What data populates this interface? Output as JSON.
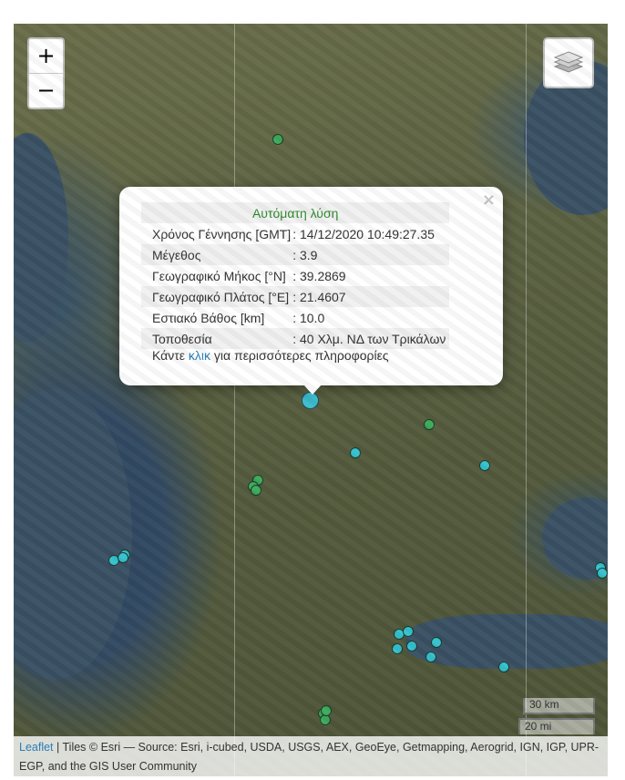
{
  "map": {
    "zoom_in": "+",
    "zoom_out": "−",
    "layers_icon": "layers-icon"
  },
  "popup": {
    "heading": "Αυτόματη λύση",
    "rows": [
      {
        "label": "Χρόνος Γέννησης [GMT]",
        "value": ": 14/12/2020 10:49:27.35"
      },
      {
        "label": "Μέγεθος",
        "value": ": 3.9"
      },
      {
        "label": "Γεωγραφικό Μήκος [°N]",
        "value": ": 39.2869"
      },
      {
        "label": "Γεωγραφικό Πλάτος [°E]",
        "value": ": 21.4607"
      },
      {
        "label": "Εστιακό Βάθος [km]",
        "value": ": 10.0"
      },
      {
        "label": "Τοποθεσία",
        "value": ": 40 Χλμ. ΝΔ των Τρικάλων"
      }
    ],
    "more_prefix": "Κάντε ",
    "more_link": "κλικ",
    "more_suffix": " για περισσότερες πληροφορίες",
    "close": "×"
  },
  "scale": {
    "km": "30 km",
    "mi": "20 mi"
  },
  "attribution": {
    "link": "Leaflet",
    "text": " | Tiles © Esri — Source: Esri, i-cubed, USDA, USGS, AEX, GeoEye, Getmapping, Aerogrid, IGN, IGP, UPR-EGP, and the GIS User Community"
  },
  "colors": {
    "popup_heading": "#2e8a2e",
    "link": "#2a7fb8",
    "marker_recent": "#35c1cf",
    "marker_older": "#3daa5a"
  }
}
